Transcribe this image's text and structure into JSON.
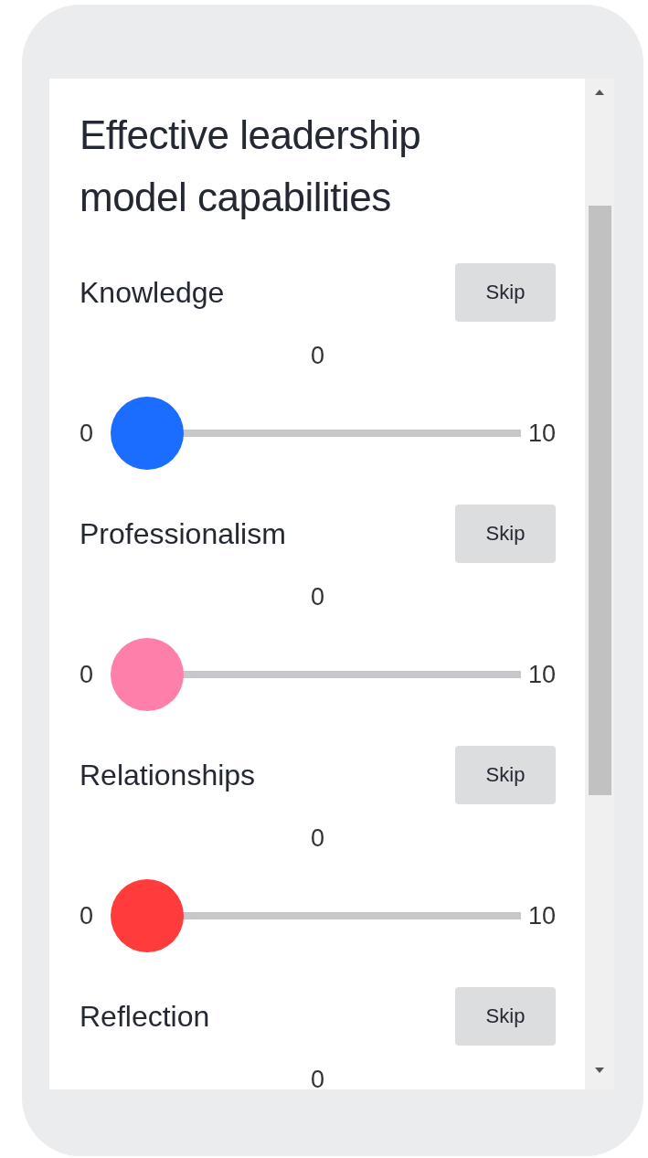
{
  "title": "Effective leadership model capabilities",
  "capabilities": [
    {
      "label": "Knowledge",
      "skip": "Skip",
      "value": "0",
      "min": "0",
      "max": "10",
      "level": 0,
      "color": "#1a6dff"
    },
    {
      "label": "Professionalism",
      "skip": "Skip",
      "value": "0",
      "min": "0",
      "max": "10",
      "level": 0,
      "color": "#ff7fab"
    },
    {
      "label": "Relationships",
      "skip": "Skip",
      "value": "0",
      "min": "0",
      "max": "10",
      "level": 0,
      "color": "#ff3b3b"
    },
    {
      "label": "Reflection",
      "skip": "Skip",
      "value": "0"
    }
  ]
}
